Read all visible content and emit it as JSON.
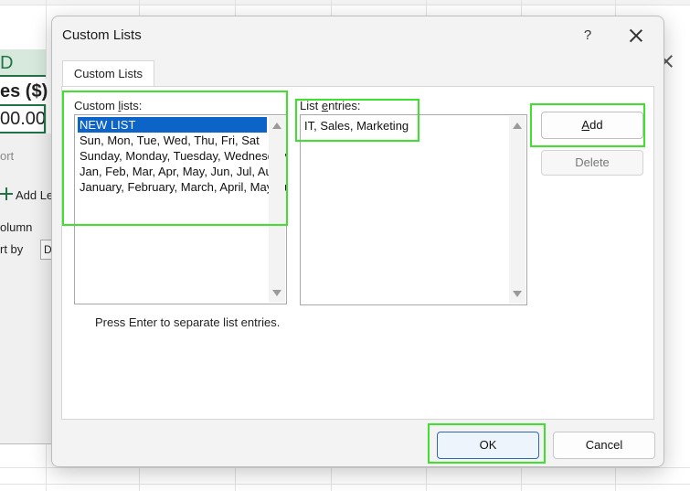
{
  "sheet": {
    "column_header": "D",
    "header_cell": "es ($)",
    "value_cell": "00.00"
  },
  "sort_dialog": {
    "sort_text": "ort",
    "add_level": "Add Le",
    "column_label": "olumn",
    "sort_by_label": "rt by",
    "sort_by_value": "D"
  },
  "dialog": {
    "title": "Custom Lists",
    "help": "?",
    "tab": "Custom Lists",
    "custom_lists_label_prefix": "Custom ",
    "custom_lists_label_key": "l",
    "custom_lists_label_suffix": "ists:",
    "custom_lists": [
      "NEW LIST",
      "Sun, Mon, Tue, Wed, Thu, Fri, Sat",
      "Sunday, Monday, Tuesday, Wednesday, Thursday, Friday, Saturday",
      "Jan, Feb, Mar, Apr, May, Jun, Jul, Aug, Sep, Oct, Nov, Dec",
      "January, February, March, April, May, June, July, August, September, October, November, December"
    ],
    "list_entries_label_prefix": "List ",
    "list_entries_label_key": "e",
    "list_entries_label_suffix": "ntries:",
    "list_entries_value": "IT, Sales, Marketing",
    "add_label_key": "A",
    "add_label_rest": "dd",
    "delete_label": "Delete",
    "hint": "Press Enter to separate list entries.",
    "ok_label": "OK",
    "cancel_label": "Cancel"
  },
  "colors": {
    "highlight": "#3ee12b",
    "selection": "#0c63c8",
    "excel_green": "#217346"
  }
}
